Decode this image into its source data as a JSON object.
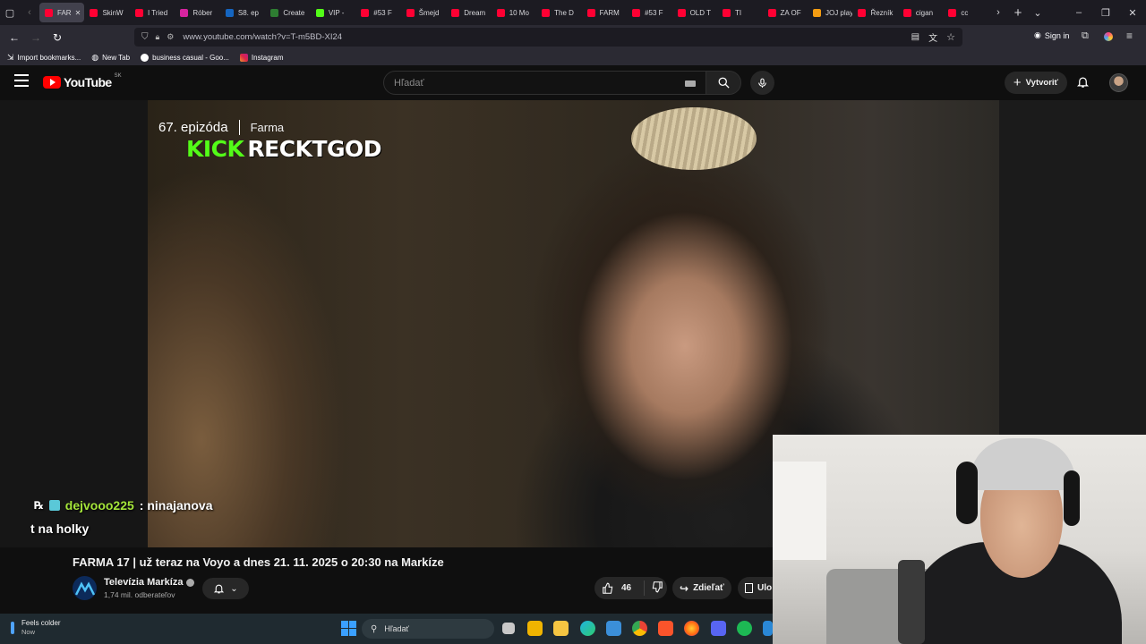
{
  "browser": {
    "tabs": [
      {
        "label": "FAR",
        "color": "#ff0033",
        "active": true
      },
      {
        "label": "SkinW",
        "color": "#ff0033"
      },
      {
        "label": "I Tried",
        "color": "#ff0033"
      },
      {
        "label": "Róber",
        "color": "#d6249f"
      },
      {
        "label": "S8. ep",
        "color": "#1565c0"
      },
      {
        "label": "Create",
        "color": "#2e7d32"
      },
      {
        "label": "VIP - ",
        "color": "#53fc18"
      },
      {
        "label": "#53 F",
        "color": "#ff0033"
      },
      {
        "label": "Šmejd",
        "color": "#ff0033"
      },
      {
        "label": "Dream",
        "color": "#ff0033"
      },
      {
        "label": "10 Mo",
        "color": "#ff0033"
      },
      {
        "label": "The D",
        "color": "#ff0033"
      },
      {
        "label": "FARM",
        "color": "#ff0033"
      },
      {
        "label": "#53 F",
        "color": "#ff0033"
      },
      {
        "label": "OLD T",
        "color": "#ff0033"
      },
      {
        "label": "TI",
        "color": "#ff0033"
      },
      {
        "label": "ZA OF",
        "color": "#ff0033"
      },
      {
        "label": "JOJ play",
        "color": "#f39c12"
      },
      {
        "label": "Řezník",
        "color": "#ff0033"
      },
      {
        "label": "cigan",
        "color": "#ff0033"
      },
      {
        "label": "cc",
        "color": "#ff0033"
      }
    ],
    "url": "www.youtube.com/watch?v=T-m5BD-XI24",
    "sign_in": "Sign in",
    "bookmarks": [
      {
        "label": "Import bookmarks...",
        "icon": "import-icon"
      },
      {
        "label": "New Tab",
        "icon": "globe-icon"
      },
      {
        "label": "business casual - Goo...",
        "icon": "google-icon"
      },
      {
        "label": "Instagram",
        "icon": "instagram-icon"
      }
    ]
  },
  "youtube": {
    "logo_text": "YouTube",
    "region": "SK",
    "search_placeholder": "Hľadať",
    "create_label": "Vytvoriť"
  },
  "video": {
    "episode": "67. epizóda",
    "show": "Farma",
    "kick_logo": "KICK",
    "kick_channel": "RECKTGOD",
    "chat_user": "dejvooo225",
    "chat_message": ": ninajanova",
    "chat_continuation": "t na holky"
  },
  "details": {
    "title": "FARMA 17 | už teraz na Voyo a dnes 21. 11. 2025 o 20:30 na Markíze",
    "channel_name": "Televízia Markíza",
    "subscribers": "1,74 mil. odberateľov",
    "likes": "46",
    "share_label": "Zdieľať",
    "save_label": "Ulo"
  },
  "taskbar": {
    "weather_title": "Feels colder",
    "weather_sub": "Now",
    "search_label": "Hľadať"
  }
}
